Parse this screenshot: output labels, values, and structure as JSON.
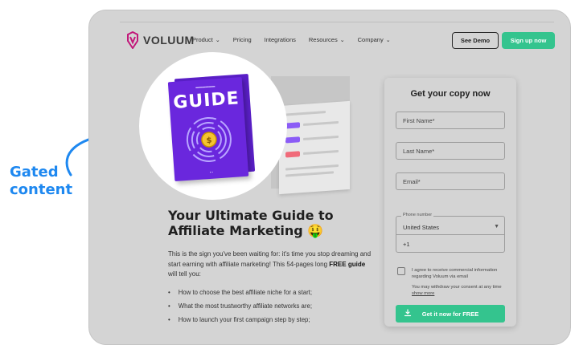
{
  "annotation": {
    "line1": "Gated",
    "line2": "content"
  },
  "nav": {
    "brand": "VOLUUM",
    "links": [
      {
        "label": "Product",
        "dropdown": true
      },
      {
        "label": "Pricing",
        "dropdown": false
      },
      {
        "label": "Integrations",
        "dropdown": false
      },
      {
        "label": "Resources",
        "dropdown": true
      },
      {
        "label": "Company",
        "dropdown": true
      }
    ],
    "see_demo": "See Demo",
    "sign_up": "Sign up now"
  },
  "book": {
    "cover_title": "GUIDE"
  },
  "main": {
    "headline": "Your Ultimate Guide to Affiliate Marketing 🤑",
    "intro_before": "This is the sign you've been waiting for: it's time you stop dreaming and start earning with affiliate marketing! This 54-pages long ",
    "intro_bold": "FREE guide",
    "intro_after": " will tell you:",
    "bullets": [
      "How to choose the best affiliate niche for a start;",
      "What the most trustworthy affiliate networks are;",
      "How to launch your first campaign step by step;"
    ]
  },
  "form": {
    "title": "Get your copy now",
    "first_name": "First Name*",
    "last_name": "Last Name*",
    "email": "Email*",
    "phone_label": "Phone number",
    "country": "United States",
    "dial_code": "+1",
    "consent": "I agree to receive commercial information regarding Voluum via email",
    "withdraw": "You may withdraw your consent at any time",
    "show_more": "show more",
    "submit": "Get it now for FREE"
  },
  "colors": {
    "accent_green": "#34c48e",
    "annotation_blue": "#1e88f0",
    "book_purple": "#6a27dd",
    "logo_magenta": "#c2187a"
  }
}
